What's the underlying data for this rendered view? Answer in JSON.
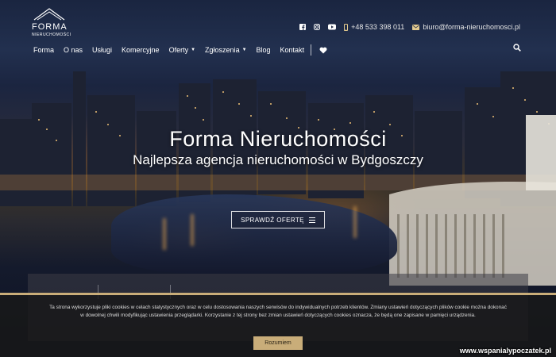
{
  "logo": {
    "main": "FORMA",
    "sub": "NIERUCHOMOŚCI"
  },
  "contacts": {
    "phone": "+48 533 398 011",
    "email": "biuro@forma-nieruchomosci.pl"
  },
  "icons": {
    "facebook": "facebook-icon",
    "instagram": "instagram-icon",
    "youtube": "youtube-icon",
    "phone": "phone-icon",
    "email": "envelope-icon",
    "heart": "heart-icon",
    "search": "search-icon",
    "menu": "menu-icon"
  },
  "nav": {
    "items": [
      {
        "label": "Forma",
        "dropdown": false
      },
      {
        "label": "O nas",
        "dropdown": false
      },
      {
        "label": "Usługi",
        "dropdown": false
      },
      {
        "label": "Komercyjne",
        "dropdown": false
      },
      {
        "label": "Oferty",
        "dropdown": true
      },
      {
        "label": "Zgłoszenia",
        "dropdown": true
      },
      {
        "label": "Blog",
        "dropdown": false
      },
      {
        "label": "Kontakt",
        "dropdown": false
      }
    ]
  },
  "hero": {
    "title": "Forma Nieruchomości",
    "subtitle": "Najlepsza agencja nieruchomości w Bydgoszczy",
    "cta": "SPRAWDŹ OFERTĘ"
  },
  "cookie": {
    "text": "Ta strona wykorzystuje pliki cookies w celach statystycznych oraz w celu dostosowania naszych serwisów do indywidualnych potrzeb klientów. Zmiany ustawień dotyczących plików cookie można dokonać w dowolnej chwili modyfikując ustawienia przeglądarki. Korzystanie z tej strony bez zmian ustawień dotyczących cookies oznacza, że będą one zapisane w pamięci urządzenia.",
    "button": "Rozumiem"
  },
  "watermark": "www.wspanialypoczatek.pl",
  "colors": {
    "accent": "#c9ad79",
    "cookie_bg": "#191919"
  }
}
